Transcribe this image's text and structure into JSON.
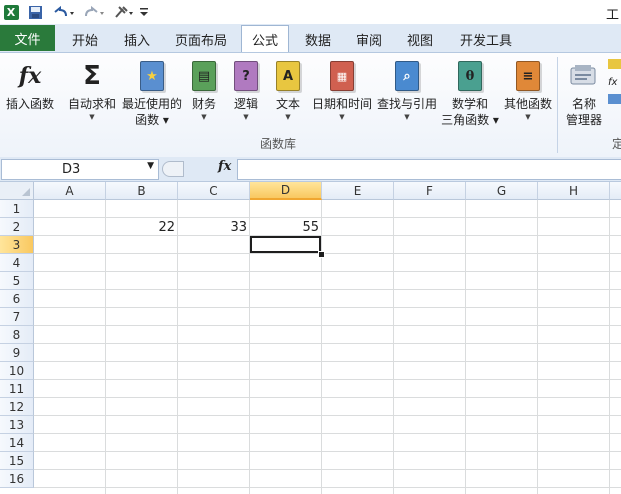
{
  "app": {
    "title_fragment": "工",
    "logo_letter": "X"
  },
  "quick_access": {
    "save_icon": "save-icon",
    "undo_icon": "undo-icon",
    "redo_icon": "redo-icon",
    "tools_icon": "tools-icon",
    "customize_icon": "customize-icon"
  },
  "tabs": [
    {
      "label": "文件"
    },
    {
      "label": "开始"
    },
    {
      "label": "插入"
    },
    {
      "label": "页面布局"
    },
    {
      "label": "公式",
      "active": true
    },
    {
      "label": "数据"
    },
    {
      "label": "审阅"
    },
    {
      "label": "视图"
    },
    {
      "label": "开发工具"
    }
  ],
  "ribbon": {
    "group_label": "函数库",
    "insert_function": {
      "icon_text": "fx",
      "label": "插入函数"
    },
    "autosum": {
      "icon_text": "Σ",
      "label": "自动求和"
    },
    "recent": {
      "label1": "最近使用的",
      "label2": "函数"
    },
    "financial": {
      "label": "财务"
    },
    "logical": {
      "icon_text": "?",
      "label": "逻辑"
    },
    "text": {
      "icon_text": "A",
      "label": "文本"
    },
    "datetime": {
      "label": "日期和时间"
    },
    "lookup": {
      "label": "查找与引用"
    },
    "math": {
      "icon_text": "θ",
      "label1": "数学和",
      "label2": "三角函数"
    },
    "more": {
      "label": "其他函数"
    },
    "name_manager": {
      "label1": "名称",
      "label2": "管理器"
    },
    "define_partial": "定",
    "colors": {
      "green": "#5aa05a",
      "yellow": "#e8c640",
      "purple": "#b07ac0",
      "orange": "#e08838",
      "blue": "#5a8fd0",
      "teal": "#4aa090",
      "red": "#d06050"
    }
  },
  "formula_bar": {
    "name_box_value": "D3",
    "fx_label": "fx",
    "formula": ""
  },
  "sheet": {
    "columns": [
      "A",
      "B",
      "C",
      "D",
      "E",
      "F",
      "G",
      "H"
    ],
    "selected_column": "D",
    "rows": [
      "1",
      "2",
      "3",
      "4",
      "5",
      "6",
      "7",
      "8",
      "9",
      "10",
      "11",
      "12",
      "13",
      "14",
      "15",
      "16"
    ],
    "selected_row": "3",
    "cells": {
      "B2": "22",
      "C2": "33",
      "D2": "55"
    }
  }
}
